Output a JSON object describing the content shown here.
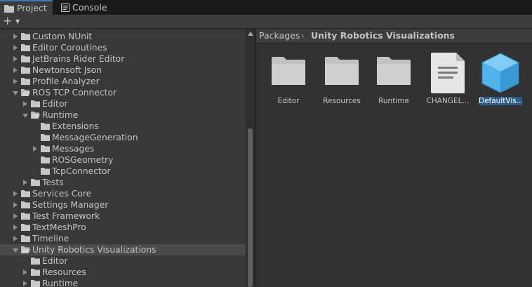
{
  "tabs": [
    {
      "label": "Project",
      "icon": "folder-icon",
      "active": true
    },
    {
      "label": "Console",
      "icon": "console-icon",
      "active": false
    }
  ],
  "toolbar": {
    "add_label": "+",
    "add_arrow": "▼"
  },
  "tree": [
    {
      "label": "Custom NUnit",
      "expandable": true,
      "expanded": false,
      "depth": 0
    },
    {
      "label": "Editor Coroutines",
      "expandable": true,
      "expanded": false,
      "depth": 0
    },
    {
      "label": "JetBrains Rider Editor",
      "expandable": true,
      "expanded": false,
      "depth": 0
    },
    {
      "label": "Newtonsoft Json",
      "expandable": true,
      "expanded": false,
      "depth": 0
    },
    {
      "label": "Profile Analyzer",
      "expandable": true,
      "expanded": false,
      "depth": 0
    },
    {
      "label": "ROS TCP Connector",
      "expandable": true,
      "expanded": true,
      "depth": 0
    },
    {
      "label": "Editor",
      "expandable": true,
      "expanded": false,
      "depth": 1
    },
    {
      "label": "Runtime",
      "expandable": true,
      "expanded": true,
      "depth": 1
    },
    {
      "label": "Extensions",
      "expandable": false,
      "expanded": false,
      "depth": 2
    },
    {
      "label": "MessageGeneration",
      "expandable": false,
      "expanded": false,
      "depth": 2
    },
    {
      "label": "Messages",
      "expandable": true,
      "expanded": false,
      "depth": 2
    },
    {
      "label": "ROSGeometry",
      "expandable": false,
      "expanded": false,
      "depth": 2
    },
    {
      "label": "TcpConnector",
      "expandable": false,
      "expanded": false,
      "depth": 2
    },
    {
      "label": "Tests",
      "expandable": true,
      "expanded": false,
      "depth": 1
    },
    {
      "label": "Services Core",
      "expandable": true,
      "expanded": false,
      "depth": 0
    },
    {
      "label": "Settings Manager",
      "expandable": true,
      "expanded": false,
      "depth": 0
    },
    {
      "label": "Test Framework",
      "expandable": true,
      "expanded": false,
      "depth": 0
    },
    {
      "label": "TextMeshPro",
      "expandable": true,
      "expanded": false,
      "depth": 0
    },
    {
      "label": "Timeline",
      "expandable": true,
      "expanded": false,
      "depth": 0
    },
    {
      "label": "Unity Robotics Visualizations",
      "expandable": true,
      "expanded": true,
      "depth": 0,
      "selected": true
    },
    {
      "label": "Editor",
      "expandable": false,
      "expanded": false,
      "depth": 1
    },
    {
      "label": "Resources",
      "expandable": true,
      "expanded": false,
      "depth": 1
    },
    {
      "label": "Runtime",
      "expandable": true,
      "expanded": false,
      "depth": 1
    }
  ],
  "breadcrumb": [
    {
      "label": "Packages",
      "bold": false
    },
    {
      "label": "Unity Robotics Visualizations",
      "bold": true
    }
  ],
  "breadcrumb_separator": "›",
  "assets": [
    {
      "label": "Editor",
      "type": "folder",
      "selected": false
    },
    {
      "label": "Resources",
      "type": "folder",
      "selected": false
    },
    {
      "label": "Runtime",
      "type": "folder",
      "selected": false
    },
    {
      "label": "CHANGEL...",
      "type": "text-document",
      "selected": false
    },
    {
      "label": "DefaultVis...",
      "type": "prefab",
      "selected": true
    }
  ],
  "colors": {
    "accent": "#3a79bb",
    "selection": "#2c5d87",
    "prefab": "#4fb3ec"
  }
}
